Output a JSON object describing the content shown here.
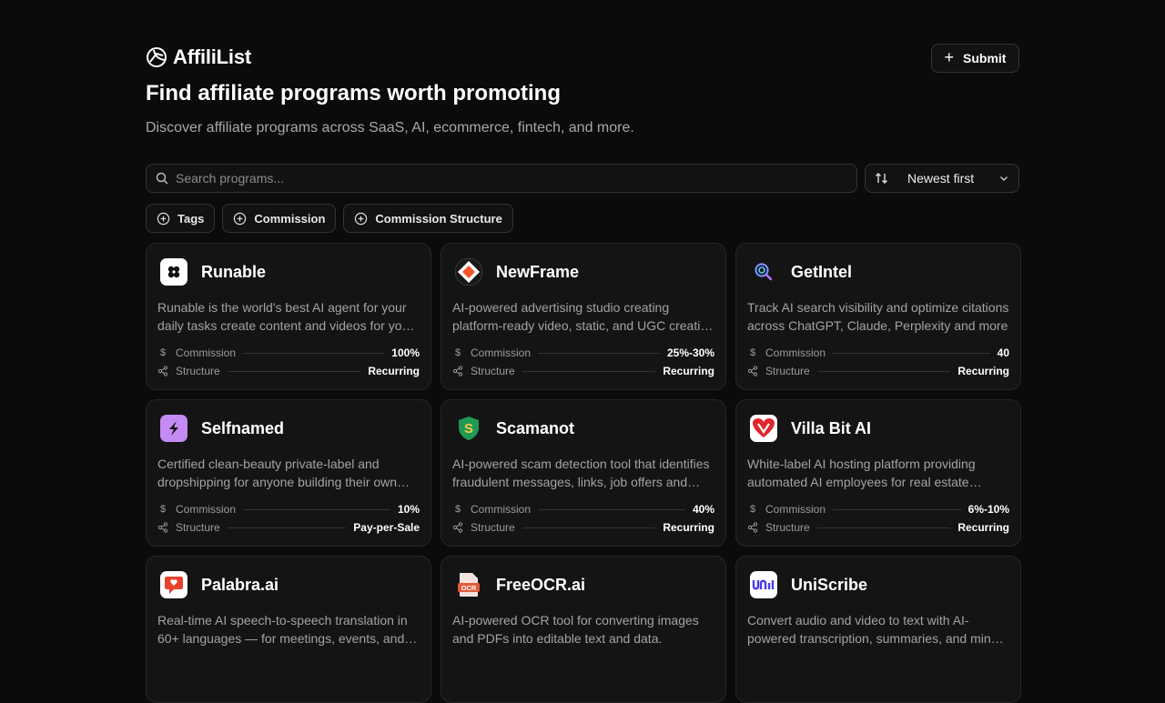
{
  "brand": {
    "name": "AffiliList"
  },
  "header": {
    "submit_label": "Submit"
  },
  "hero": {
    "title": "Find affiliate programs worth promoting",
    "subtitle": "Discover affiliate programs across SaaS, AI, ecommerce, fintech, and more."
  },
  "search": {
    "placeholder": "Search programs..."
  },
  "sort": {
    "selected": "Newest first"
  },
  "filters": [
    "Tags",
    "Commission",
    "Commission Structure"
  ],
  "labels": {
    "commission": "Commission",
    "structure": "Structure"
  },
  "programs": [
    {
      "name": "Runable",
      "description": "Runable is the world's best AI agent for your daily tasks create content and videos for your business",
      "commission": "100%",
      "structure": "Recurring",
      "logo_bg": "#ffffff",
      "logo_icon": "flower-icon"
    },
    {
      "name": "NewFrame",
      "description": "AI-powered advertising studio creating platform-ready video, static, and UGC creative for brands",
      "commission": "25%-30%",
      "structure": "Recurring",
      "logo_bg": "#ffffff",
      "logo_icon": "diamond-frame-icon"
    },
    {
      "name": "GetIntel",
      "description": "Track AI search visibility and optimize citations across ChatGPT, Claude, Perplexity and more",
      "commission": "40",
      "structure": "Recurring",
      "logo_bg": "#141414",
      "logo_icon": "magnifier-icon"
    },
    {
      "name": "Selfnamed",
      "description": "Certified clean-beauty private-label and dropshipping for anyone building their own brand",
      "commission": "10%",
      "structure": "Pay-per-Sale",
      "logo_bg": "#c48bf5",
      "logo_icon": "s-mark-icon"
    },
    {
      "name": "Scamanot",
      "description": "AI-powered scam detection tool that identifies fraudulent messages, links, job offers and more",
      "commission": "40%",
      "structure": "Recurring",
      "logo_bg": "#141414",
      "logo_icon": "shield-icon"
    },
    {
      "name": "Villa Bit AI",
      "description": "White-label AI hosting platform providing automated AI employees for real estate agencies",
      "commission": "6%-10%",
      "structure": "Recurring",
      "logo_bg": "#ffffff",
      "logo_icon": "heart-v-icon"
    },
    {
      "name": "Palabra.ai",
      "description": "Real-time AI speech-to-speech translation in 60+ languages — for meetings, events, and streams",
      "commission": "",
      "structure": "",
      "logo_bg": "#ffffff",
      "logo_icon": "speech-bubble-icon"
    },
    {
      "name": "FreeOCR.ai",
      "description": "AI-powered OCR tool for converting images and PDFs into editable text and data.",
      "commission": "",
      "structure": "",
      "logo_bg": "#141414",
      "logo_icon": "ocr-doc-icon"
    },
    {
      "name": "UniScribe",
      "description": "Convert audio and video to text with AI-powered transcription, summaries, and mind maps",
      "commission": "",
      "structure": "",
      "logo_bg": "#ffffff",
      "logo_icon": "uni-wordmark-icon"
    }
  ]
}
